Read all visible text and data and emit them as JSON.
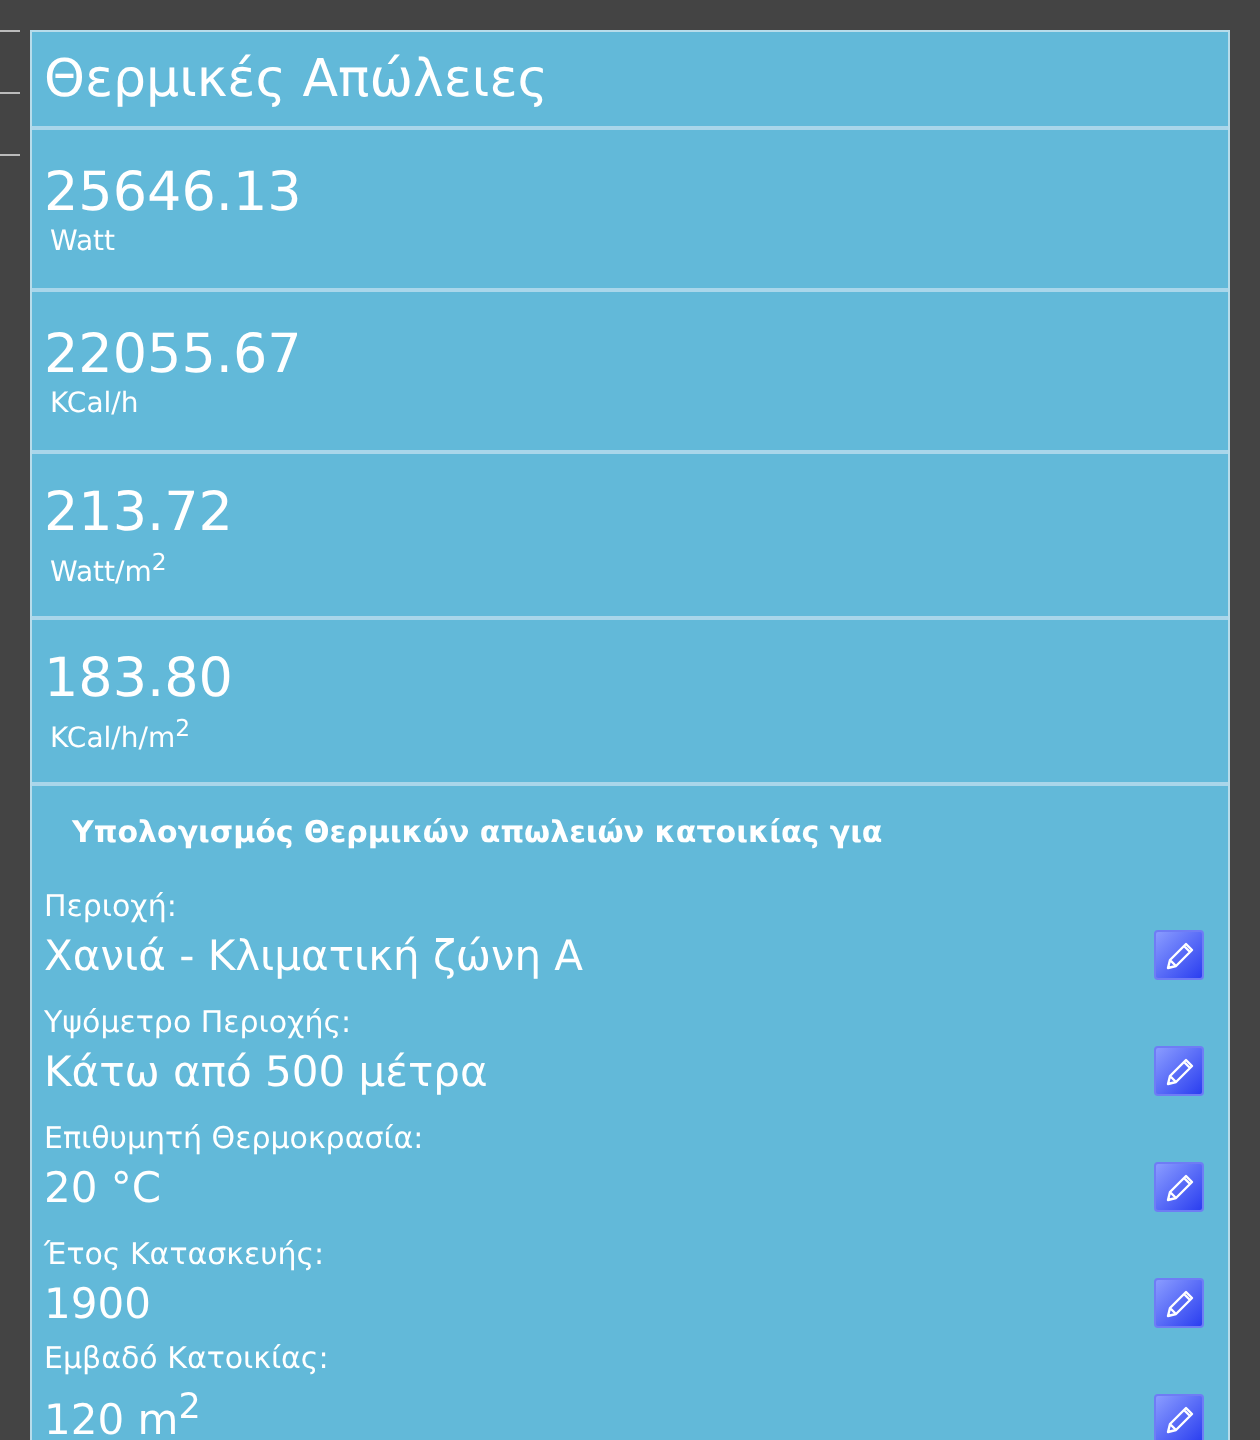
{
  "title": "Θερμικές Απώλειες",
  "results": [
    {
      "value": "25646.13",
      "unit": "Watt"
    },
    {
      "value": "22055.67",
      "unit": "KCal/h"
    },
    {
      "value": "213.72",
      "unit": "Watt/m$^{2}$"
    },
    {
      "value": "183.80",
      "unit": "KCal/h/m$^{2}$"
    }
  ],
  "inputs_heading": "Υπολογισμός Θερμικών απωλειών κατοικίας για",
  "inputs": [
    {
      "label": "Περιοχή:",
      "value": "Χανιά - Κλιματική ζώνη Α"
    },
    {
      "label": "Υψόμετρο Περιοχής:",
      "value": "Κάτω από 500 μέτρα"
    },
    {
      "label": "Επιθυμητή Θερμοκρασία:",
      "value": "20 °C"
    },
    {
      "label": "Έτος Κατασκευής:",
      "value": "1900"
    },
    {
      "label": "Εμβαδό Κατοικίας:",
      "value": "120 m$^{2}$"
    }
  ]
}
